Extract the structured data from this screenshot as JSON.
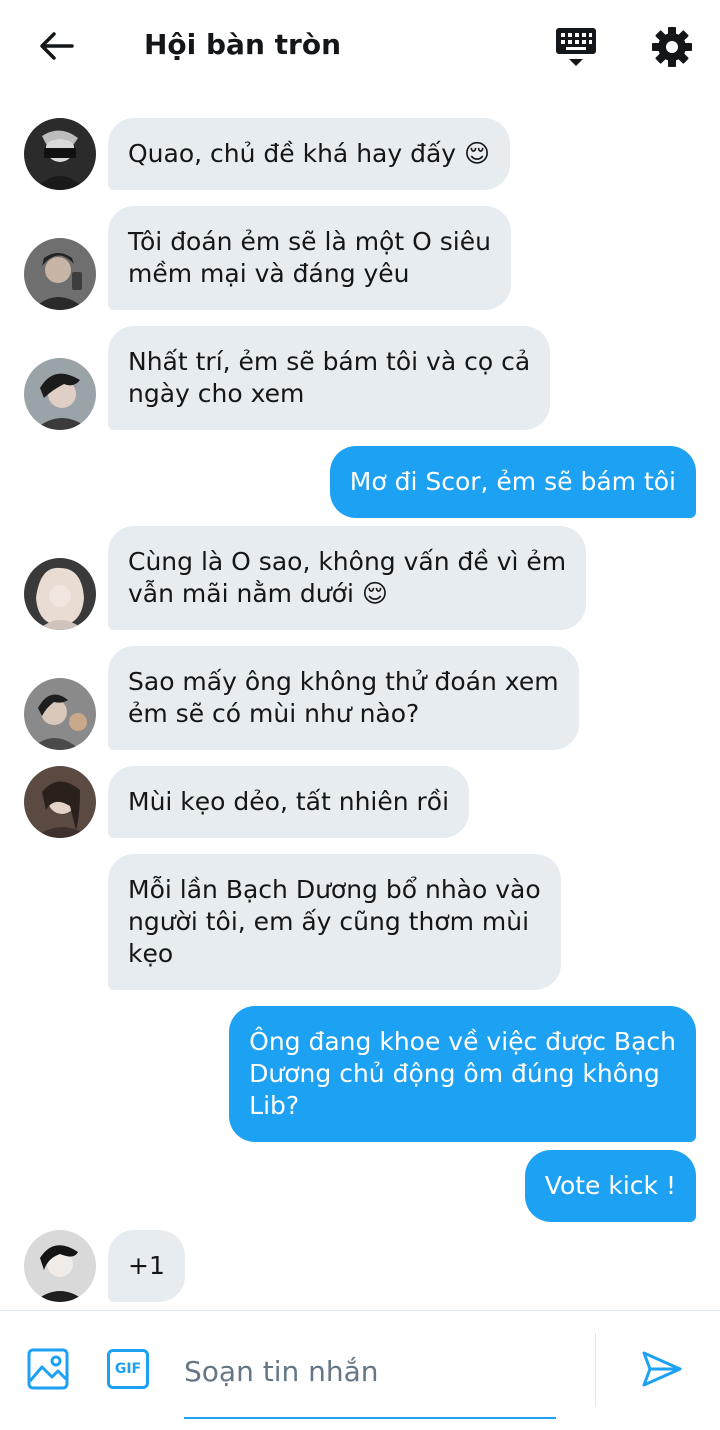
{
  "header": {
    "title": "Hội bàn tròn",
    "icons": {
      "back": "arrow-left-icon",
      "keyboard": "keyboard-icon",
      "settings": "gear-icon"
    }
  },
  "messages": [
    {
      "direction": "in",
      "text": "Quao, chủ đề khá hay đấy 😌"
    },
    {
      "direction": "in",
      "text": "Tôi đoán ẻm sẽ là một O siêu\nmềm mại và đáng yêu"
    },
    {
      "direction": "in",
      "text": "Nhất trí, ẻm sẽ bám tôi và cọ cả\nngày cho xem"
    },
    {
      "direction": "out",
      "text": "Mơ đi Scor, ẻm sẽ bám tôi"
    },
    {
      "direction": "in",
      "text": "Cùng là O sao, không vấn đề vì ẻm\nvẫn mãi nằm dưới 😌"
    },
    {
      "direction": "in",
      "text": "Sao mấy ông không thử đoán xem\nẻm sẽ có mùi như nào?"
    },
    {
      "direction": "in",
      "text": "Mùi kẹo dẻo, tất nhiên rồi"
    },
    {
      "direction": "in",
      "text": "Mỗi lần Bạch Dương bổ nhào vào\nngười tôi, em ấy cũng thơm mùi\nkẹo"
    },
    {
      "direction": "out",
      "text": "Ông đang khoe về việc được Bạch\nDương chủ động ôm đúng không\nLib?"
    },
    {
      "direction": "out",
      "text": "Vote kick !"
    },
    {
      "direction": "in",
      "text": "+1"
    }
  ],
  "composer": {
    "placeholder": "Soạn tin nhắn",
    "gif_label": "GIF",
    "icons": {
      "image": "image-icon",
      "gif": "gif-icon",
      "send": "send-icon"
    }
  },
  "colors": {
    "accent": "#1da1f2",
    "incoming_bubble": "#e6ecf0",
    "text": "#14171a"
  }
}
